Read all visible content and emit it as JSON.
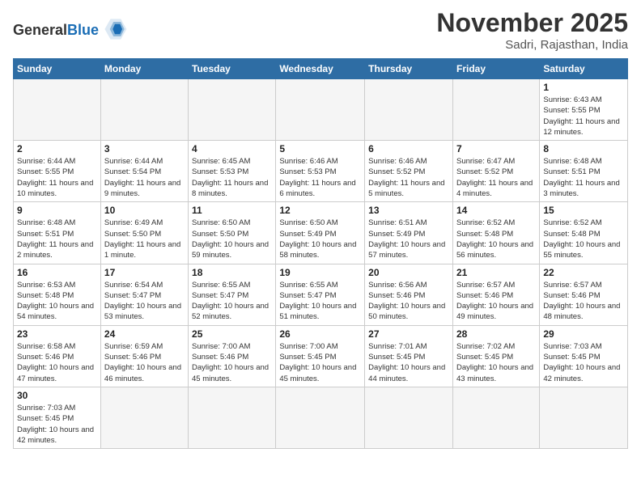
{
  "header": {
    "logo_general": "General",
    "logo_blue": "Blue",
    "month_title": "November 2025",
    "location": "Sadri, Rajasthan, India"
  },
  "days_of_week": [
    "Sunday",
    "Monday",
    "Tuesday",
    "Wednesday",
    "Thursday",
    "Friday",
    "Saturday"
  ],
  "weeks": [
    [
      {
        "day": "",
        "info": ""
      },
      {
        "day": "",
        "info": ""
      },
      {
        "day": "",
        "info": ""
      },
      {
        "day": "",
        "info": ""
      },
      {
        "day": "",
        "info": ""
      },
      {
        "day": "",
        "info": ""
      },
      {
        "day": "1",
        "info": "Sunrise: 6:43 AM\nSunset: 5:55 PM\nDaylight: 11 hours and 12 minutes."
      }
    ],
    [
      {
        "day": "2",
        "info": "Sunrise: 6:44 AM\nSunset: 5:55 PM\nDaylight: 11 hours and 10 minutes."
      },
      {
        "day": "3",
        "info": "Sunrise: 6:44 AM\nSunset: 5:54 PM\nDaylight: 11 hours and 9 minutes."
      },
      {
        "day": "4",
        "info": "Sunrise: 6:45 AM\nSunset: 5:53 PM\nDaylight: 11 hours and 8 minutes."
      },
      {
        "day": "5",
        "info": "Sunrise: 6:46 AM\nSunset: 5:53 PM\nDaylight: 11 hours and 6 minutes."
      },
      {
        "day": "6",
        "info": "Sunrise: 6:46 AM\nSunset: 5:52 PM\nDaylight: 11 hours and 5 minutes."
      },
      {
        "day": "7",
        "info": "Sunrise: 6:47 AM\nSunset: 5:52 PM\nDaylight: 11 hours and 4 minutes."
      },
      {
        "day": "8",
        "info": "Sunrise: 6:48 AM\nSunset: 5:51 PM\nDaylight: 11 hours and 3 minutes."
      }
    ],
    [
      {
        "day": "9",
        "info": "Sunrise: 6:48 AM\nSunset: 5:51 PM\nDaylight: 11 hours and 2 minutes."
      },
      {
        "day": "10",
        "info": "Sunrise: 6:49 AM\nSunset: 5:50 PM\nDaylight: 11 hours and 1 minute."
      },
      {
        "day": "11",
        "info": "Sunrise: 6:50 AM\nSunset: 5:50 PM\nDaylight: 10 hours and 59 minutes."
      },
      {
        "day": "12",
        "info": "Sunrise: 6:50 AM\nSunset: 5:49 PM\nDaylight: 10 hours and 58 minutes."
      },
      {
        "day": "13",
        "info": "Sunrise: 6:51 AM\nSunset: 5:49 PM\nDaylight: 10 hours and 57 minutes."
      },
      {
        "day": "14",
        "info": "Sunrise: 6:52 AM\nSunset: 5:48 PM\nDaylight: 10 hours and 56 minutes."
      },
      {
        "day": "15",
        "info": "Sunrise: 6:52 AM\nSunset: 5:48 PM\nDaylight: 10 hours and 55 minutes."
      }
    ],
    [
      {
        "day": "16",
        "info": "Sunrise: 6:53 AM\nSunset: 5:48 PM\nDaylight: 10 hours and 54 minutes."
      },
      {
        "day": "17",
        "info": "Sunrise: 6:54 AM\nSunset: 5:47 PM\nDaylight: 10 hours and 53 minutes."
      },
      {
        "day": "18",
        "info": "Sunrise: 6:55 AM\nSunset: 5:47 PM\nDaylight: 10 hours and 52 minutes."
      },
      {
        "day": "19",
        "info": "Sunrise: 6:55 AM\nSunset: 5:47 PM\nDaylight: 10 hours and 51 minutes."
      },
      {
        "day": "20",
        "info": "Sunrise: 6:56 AM\nSunset: 5:46 PM\nDaylight: 10 hours and 50 minutes."
      },
      {
        "day": "21",
        "info": "Sunrise: 6:57 AM\nSunset: 5:46 PM\nDaylight: 10 hours and 49 minutes."
      },
      {
        "day": "22",
        "info": "Sunrise: 6:57 AM\nSunset: 5:46 PM\nDaylight: 10 hours and 48 minutes."
      }
    ],
    [
      {
        "day": "23",
        "info": "Sunrise: 6:58 AM\nSunset: 5:46 PM\nDaylight: 10 hours and 47 minutes."
      },
      {
        "day": "24",
        "info": "Sunrise: 6:59 AM\nSunset: 5:46 PM\nDaylight: 10 hours and 46 minutes."
      },
      {
        "day": "25",
        "info": "Sunrise: 7:00 AM\nSunset: 5:46 PM\nDaylight: 10 hours and 45 minutes."
      },
      {
        "day": "26",
        "info": "Sunrise: 7:00 AM\nSunset: 5:45 PM\nDaylight: 10 hours and 45 minutes."
      },
      {
        "day": "27",
        "info": "Sunrise: 7:01 AM\nSunset: 5:45 PM\nDaylight: 10 hours and 44 minutes."
      },
      {
        "day": "28",
        "info": "Sunrise: 7:02 AM\nSunset: 5:45 PM\nDaylight: 10 hours and 43 minutes."
      },
      {
        "day": "29",
        "info": "Sunrise: 7:03 AM\nSunset: 5:45 PM\nDaylight: 10 hours and 42 minutes."
      }
    ],
    [
      {
        "day": "30",
        "info": "Sunrise: 7:03 AM\nSunset: 5:45 PM\nDaylight: 10 hours and 42 minutes."
      },
      {
        "day": "",
        "info": ""
      },
      {
        "day": "",
        "info": ""
      },
      {
        "day": "",
        "info": ""
      },
      {
        "day": "",
        "info": ""
      },
      {
        "day": "",
        "info": ""
      },
      {
        "day": "",
        "info": ""
      }
    ]
  ]
}
